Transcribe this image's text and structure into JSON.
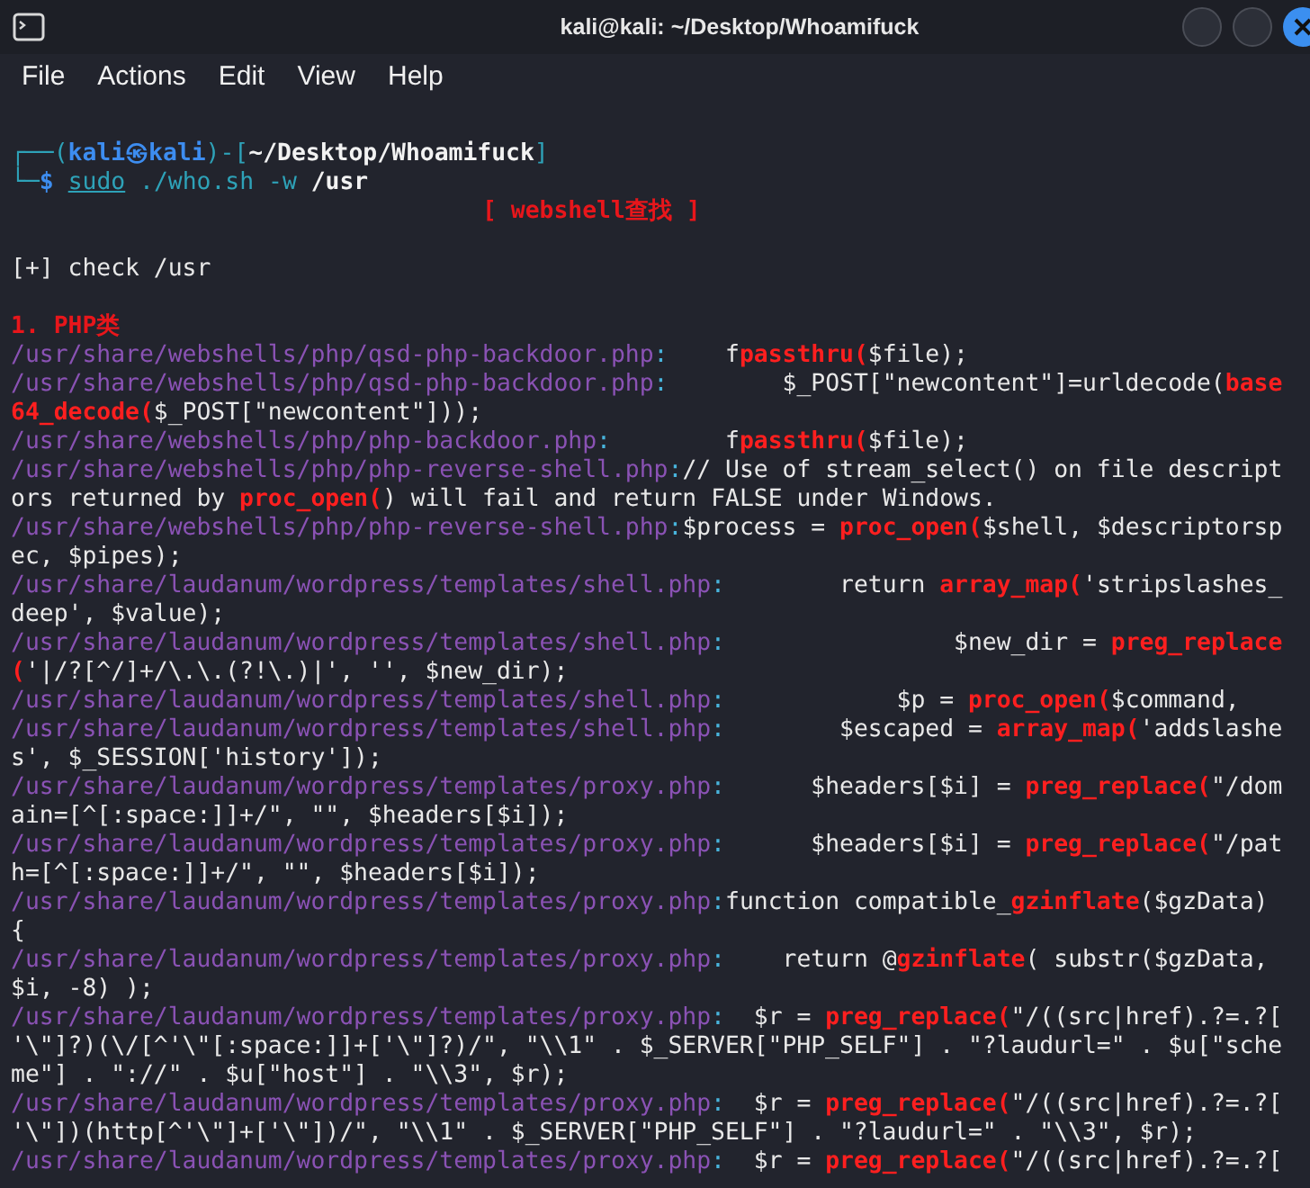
{
  "window": {
    "title": "kali@kali: ~/Desktop/Whoamifuck"
  },
  "menu": [
    "File",
    "Actions",
    "Edit",
    "View",
    "Help"
  ],
  "lines": [
    {
      "kind": "blank"
    },
    {
      "kind": "text",
      "segments": [
        {
          "kind": "frame",
          "text": "┌──("
        },
        {
          "kind": "user",
          "text": "kali㉿kali"
        },
        {
          "kind": "frame",
          "text": ")-["
        },
        {
          "kind": "cwd",
          "text": "~/Desktop/Whoamifuck"
        },
        {
          "kind": "frame",
          "text": "]"
        }
      ]
    },
    {
      "kind": "text",
      "segments": [
        {
          "kind": "frame",
          "text": "└─"
        },
        {
          "kind": "symbol",
          "text": "$"
        },
        {
          "kind": "sudo",
          "text": "sudo"
        },
        {
          "kind": "command",
          "text": " ./who.sh -w "
        },
        {
          "kind": "arg",
          "text": "/usr"
        }
      ]
    },
    {
      "kind": "banner",
      "segments": [
        {
          "kind": "banner",
          "text": "[ webshell查找 ]"
        }
      ]
    },
    {
      "kind": "blank"
    },
    {
      "kind": "text",
      "segments": [
        {
          "kind": "plain",
          "text": "[+] check /usr"
        }
      ]
    },
    {
      "kind": "blank"
    },
    {
      "kind": "text",
      "segments": [
        {
          "kind": "heading",
          "text": "1. PHP类"
        }
      ]
    },
    {
      "kind": "text",
      "segments": [
        {
          "kind": "path",
          "text": "/usr/share/webshells/php/qsd-php-backdoor.php"
        },
        {
          "kind": "colon",
          "text": ":"
        },
        {
          "kind": "code",
          "text": "    f"
        },
        {
          "kind": "match",
          "text": "passthru("
        },
        {
          "kind": "code",
          "text": "$file);"
        }
      ]
    },
    {
      "kind": "text",
      "segments": [
        {
          "kind": "path",
          "text": "/usr/share/webshells/php/qsd-php-backdoor.php"
        },
        {
          "kind": "colon",
          "text": ":"
        },
        {
          "kind": "code",
          "text": "        $_POST[\"newcontent\"]=urldecode("
        },
        {
          "kind": "match",
          "text": "base"
        }
      ]
    },
    {
      "kind": "text",
      "segments": [
        {
          "kind": "match",
          "text": "64_decode("
        },
        {
          "kind": "code",
          "text": "$_POST[\"newcontent\"]));"
        }
      ]
    },
    {
      "kind": "text",
      "segments": [
        {
          "kind": "path",
          "text": "/usr/share/webshells/php/php-backdoor.php"
        },
        {
          "kind": "colon",
          "text": ":"
        },
        {
          "kind": "code",
          "text": "        f"
        },
        {
          "kind": "match",
          "text": "passthru("
        },
        {
          "kind": "code",
          "text": "$file);"
        }
      ]
    },
    {
      "kind": "text",
      "segments": [
        {
          "kind": "path",
          "text": "/usr/share/webshells/php/php-reverse-shell.php"
        },
        {
          "kind": "colon",
          "text": ":"
        },
        {
          "kind": "code",
          "text": "// Use of stream_select() on file descript"
        }
      ]
    },
    {
      "kind": "text",
      "segments": [
        {
          "kind": "code",
          "text": "ors returned by "
        },
        {
          "kind": "match",
          "text": "proc_open("
        },
        {
          "kind": "code",
          "text": ") will fail and return FALSE under Windows."
        }
      ]
    },
    {
      "kind": "text",
      "segments": [
        {
          "kind": "path",
          "text": "/usr/share/webshells/php/php-reverse-shell.php"
        },
        {
          "kind": "colon",
          "text": ":"
        },
        {
          "kind": "code",
          "text": "$process = "
        },
        {
          "kind": "match",
          "text": "proc_open("
        },
        {
          "kind": "code",
          "text": "$shell, $descriptorsp"
        }
      ]
    },
    {
      "kind": "text",
      "segments": [
        {
          "kind": "code",
          "text": "ec, $pipes);"
        }
      ]
    },
    {
      "kind": "text",
      "segments": [
        {
          "kind": "path",
          "text": "/usr/share/laudanum/wordpress/templates/shell.php"
        },
        {
          "kind": "colon",
          "text": ":"
        },
        {
          "kind": "code",
          "text": "        return "
        },
        {
          "kind": "match",
          "text": "array_map("
        },
        {
          "kind": "code",
          "text": "'stripslashes_"
        }
      ]
    },
    {
      "kind": "text",
      "segments": [
        {
          "kind": "code",
          "text": "deep', $value);"
        }
      ]
    },
    {
      "kind": "text",
      "segments": [
        {
          "kind": "path",
          "text": "/usr/share/laudanum/wordpress/templates/shell.php"
        },
        {
          "kind": "colon",
          "text": ":"
        },
        {
          "kind": "code",
          "text": "                $new_dir = "
        },
        {
          "kind": "match",
          "text": "preg_replace"
        }
      ]
    },
    {
      "kind": "text",
      "segments": [
        {
          "kind": "match",
          "text": "("
        },
        {
          "kind": "code",
          "text": "'|/?[^/]+/\\.\\.(?!\\.)|', '', $new_dir);"
        }
      ]
    },
    {
      "kind": "text",
      "segments": [
        {
          "kind": "path",
          "text": "/usr/share/laudanum/wordpress/templates/shell.php"
        },
        {
          "kind": "colon",
          "text": ":"
        },
        {
          "kind": "code",
          "text": "            $p = "
        },
        {
          "kind": "match",
          "text": "proc_open("
        },
        {
          "kind": "code",
          "text": "$command,"
        }
      ]
    },
    {
      "kind": "text",
      "segments": [
        {
          "kind": "path",
          "text": "/usr/share/laudanum/wordpress/templates/shell.php"
        },
        {
          "kind": "colon",
          "text": ":"
        },
        {
          "kind": "code",
          "text": "        $escaped = "
        },
        {
          "kind": "match",
          "text": "array_map("
        },
        {
          "kind": "code",
          "text": "'addslashe"
        }
      ]
    },
    {
      "kind": "text",
      "segments": [
        {
          "kind": "code",
          "text": "s', $_SESSION['history']);"
        }
      ]
    },
    {
      "kind": "text",
      "segments": [
        {
          "kind": "path",
          "text": "/usr/share/laudanum/wordpress/templates/proxy.php"
        },
        {
          "kind": "colon",
          "text": ":"
        },
        {
          "kind": "code",
          "text": "      $headers[$i] = "
        },
        {
          "kind": "match",
          "text": "preg_replace("
        },
        {
          "kind": "code",
          "text": "\"/dom"
        }
      ]
    },
    {
      "kind": "text",
      "segments": [
        {
          "kind": "code",
          "text": "ain=[^[:space:]]+/\", \"\", $headers[$i]);"
        }
      ]
    },
    {
      "kind": "text",
      "segments": [
        {
          "kind": "path",
          "text": "/usr/share/laudanum/wordpress/templates/proxy.php"
        },
        {
          "kind": "colon",
          "text": ":"
        },
        {
          "kind": "code",
          "text": "      $headers[$i] = "
        },
        {
          "kind": "match",
          "text": "preg_replace("
        },
        {
          "kind": "code",
          "text": "\"/pat"
        }
      ]
    },
    {
      "kind": "text",
      "segments": [
        {
          "kind": "code",
          "text": "h=[^[:space:]]+/\", \"\", $headers[$i]);"
        }
      ]
    },
    {
      "kind": "text",
      "segments": [
        {
          "kind": "path",
          "text": "/usr/share/laudanum/wordpress/templates/proxy.php"
        },
        {
          "kind": "colon",
          "text": ":"
        },
        {
          "kind": "code",
          "text": "function compatible_"
        },
        {
          "kind": "match",
          "text": "gzinflate"
        },
        {
          "kind": "code",
          "text": "($gzData)"
        }
      ]
    },
    {
      "kind": "text",
      "segments": [
        {
          "kind": "code",
          "text": "{"
        }
      ]
    },
    {
      "kind": "text",
      "segments": [
        {
          "kind": "path",
          "text": "/usr/share/laudanum/wordpress/templates/proxy.php"
        },
        {
          "kind": "colon",
          "text": ":"
        },
        {
          "kind": "code",
          "text": "    return @"
        },
        {
          "kind": "match",
          "text": "gzinflate"
        },
        {
          "kind": "code",
          "text": "( substr($gzData,"
        }
      ]
    },
    {
      "kind": "text",
      "segments": [
        {
          "kind": "code",
          "text": "$i, -8) );"
        }
      ]
    },
    {
      "kind": "text",
      "segments": [
        {
          "kind": "path",
          "text": "/usr/share/laudanum/wordpress/templates/proxy.php"
        },
        {
          "kind": "colon",
          "text": ":"
        },
        {
          "kind": "code",
          "text": "  $r = "
        },
        {
          "kind": "match",
          "text": "preg_replace("
        },
        {
          "kind": "code",
          "text": "\"/((src|href).?=.?["
        }
      ]
    },
    {
      "kind": "text",
      "segments": [
        {
          "kind": "code",
          "text": "'\\\"]?)(\\/[^'\\\"[:space:]]+['\\\"]?)/\", \"\\\\1\" . $_SERVER[\"PHP_SELF\"] . \"?laudurl=\" . $u[\"sche"
        }
      ]
    },
    {
      "kind": "text",
      "segments": [
        {
          "kind": "code",
          "text": "me\"] . \"://\" . $u[\"host\"] . \"\\\\3\", $r);"
        }
      ]
    },
    {
      "kind": "text",
      "segments": [
        {
          "kind": "path",
          "text": "/usr/share/laudanum/wordpress/templates/proxy.php"
        },
        {
          "kind": "colon",
          "text": ":"
        },
        {
          "kind": "code",
          "text": "  $r = "
        },
        {
          "kind": "match",
          "text": "preg_replace("
        },
        {
          "kind": "code",
          "text": "\"/((src|href).?=.?["
        }
      ]
    },
    {
      "kind": "text",
      "segments": [
        {
          "kind": "code",
          "text": "'\\\"])(http[^'\\\"]+['\\\"])/\", \"\\\\1\" . $_SERVER[\"PHP_SELF\"] . \"?laudurl=\" . \"\\\\3\", $r);"
        }
      ]
    },
    {
      "kind": "text",
      "segments": [
        {
          "kind": "path",
          "text": "/usr/share/laudanum/wordpress/templates/proxy.php"
        },
        {
          "kind": "colon",
          "text": ":"
        },
        {
          "kind": "code",
          "text": "  $r = "
        },
        {
          "kind": "match",
          "text": "preg_replace("
        },
        {
          "kind": "code",
          "text": "\"/((src|href).?=.?["
        }
      ]
    }
  ]
}
